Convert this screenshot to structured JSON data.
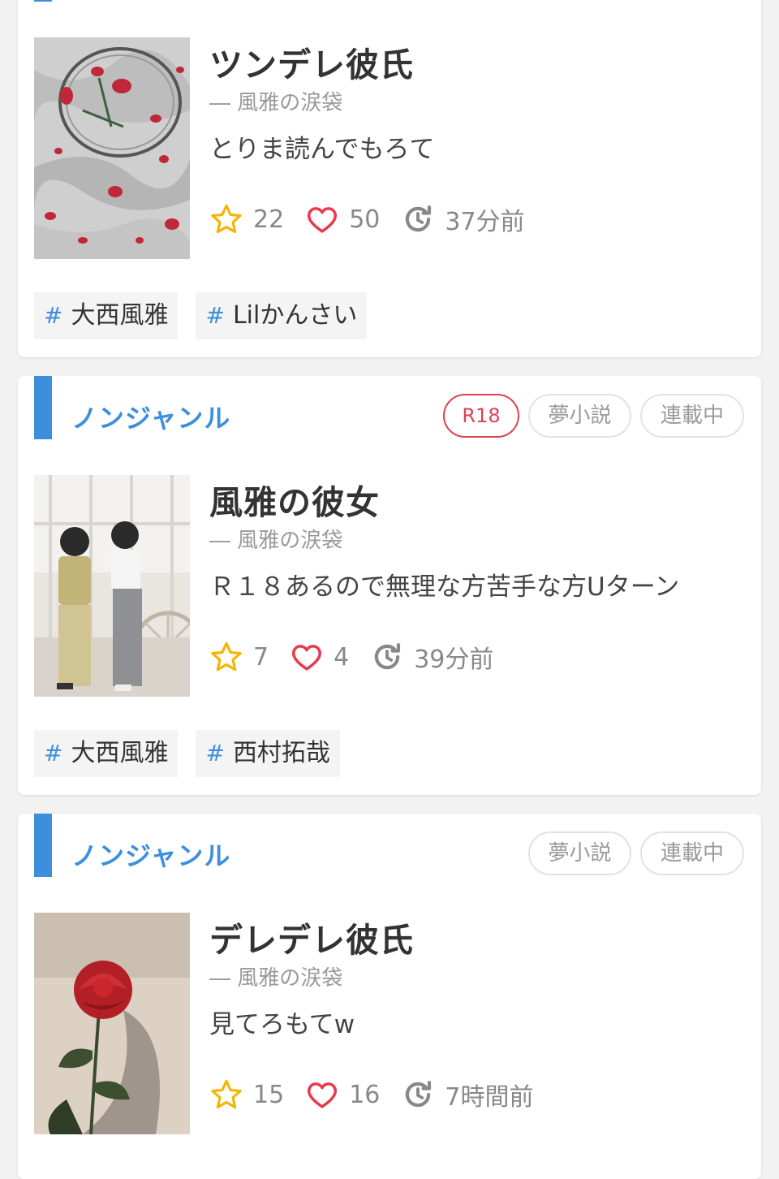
{
  "cards": [
    {
      "title": "ツンデレ彼氏",
      "author": "― 風雅の涙袋",
      "description": "とりま読んでもろて",
      "stars": "22",
      "likes": "50",
      "updated": "37分前",
      "tags": [
        "大西風雅",
        "Lilかんさい"
      ]
    },
    {
      "genre": "ノンジャンル",
      "badges": [
        "R18",
        "夢小説",
        "連載中"
      ],
      "title": "風雅の彼女",
      "author": "― 風雅の涙袋",
      "description": "Ｒ１８あるので無理な方苦手な方Uターン",
      "stars": "7",
      "likes": "4",
      "updated": "39分前",
      "tags": [
        "大西風雅",
        "西村拓哉"
      ]
    },
    {
      "genre": "ノンジャンル",
      "badges": [
        "夢小説",
        "連載中"
      ],
      "title": "デレデレ彼氏",
      "author": "― 風雅の涙袋",
      "description": "見てろもてw",
      "stars": "15",
      "likes": "16",
      "updated": "7時間前"
    }
  ],
  "icons": {
    "star": "star-icon",
    "heart": "heart-icon",
    "updated": "refresh-clock-icon",
    "tag": "hash-icon"
  },
  "colors": {
    "accent": "#3d8fdd",
    "r18": "#e04050",
    "star": "#f5b400",
    "heart": "#e8394d"
  }
}
